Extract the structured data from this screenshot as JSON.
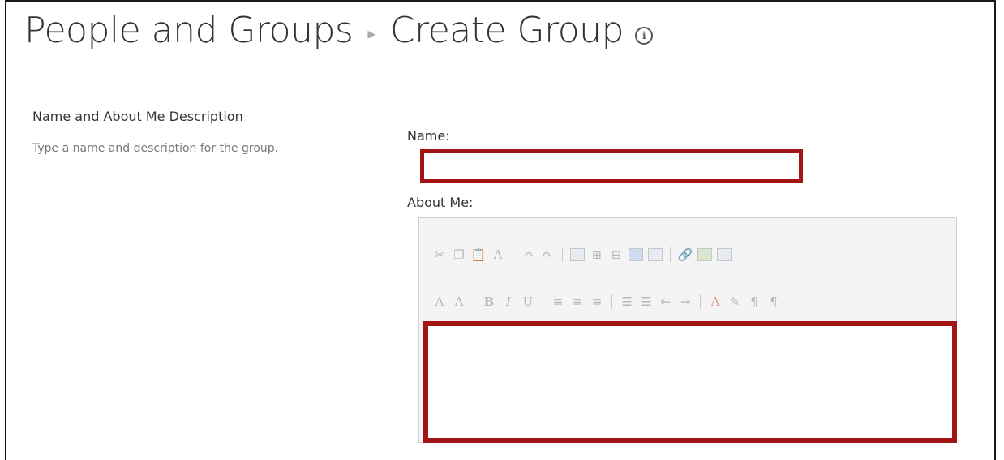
{
  "header": {
    "breadcrumb_parent": "People and Groups",
    "separator": "▸",
    "page_title": "Create Group"
  },
  "section": {
    "title": "Name and About Me Description",
    "description": "Type a name and description for the group."
  },
  "form": {
    "name_label": "Name:",
    "name_value": "",
    "about_label": "About Me:",
    "about_value": ""
  },
  "toolbar": {
    "row1": [
      "cut-icon",
      "copy-icon",
      "paste-icon",
      "spell-check-icon",
      "undo-icon",
      "redo-icon",
      "insert-table-icon",
      "insert-row-icon",
      "insert-column-icon",
      "table-grid-icon",
      "table-properties-icon",
      "insert-hyperlink-icon",
      "insert-image-icon",
      "insert-web-part-icon"
    ],
    "row2": [
      "font-size-icon",
      "font-style-icon",
      "bold-icon",
      "italic-icon",
      "underline-icon",
      "align-left-icon",
      "align-center-icon",
      "align-right-icon",
      "numbered-list-icon",
      "bullet-list-icon",
      "decrease-indent-icon",
      "increase-indent-icon",
      "font-color-icon",
      "highlight-icon",
      "ltr-icon",
      "rtl-icon"
    ]
  },
  "colors": {
    "highlight_border": "#a31515",
    "toolbar_bg": "#f4f4f4"
  }
}
